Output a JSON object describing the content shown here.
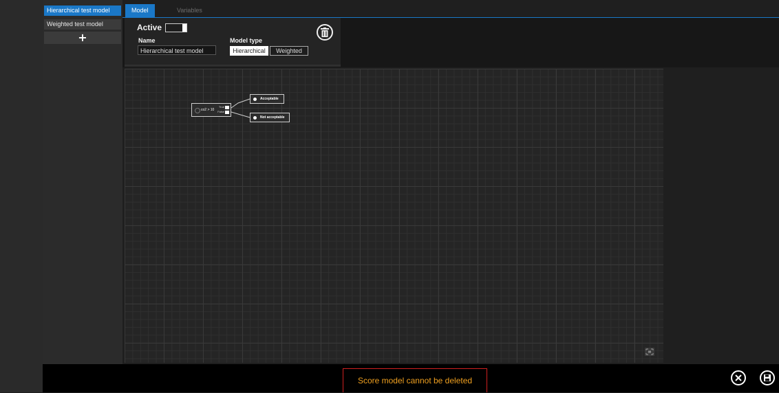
{
  "sidebar": {
    "items": [
      {
        "label": "Hierarchical test model",
        "active": true
      },
      {
        "label": "Weighted test model",
        "active": false
      }
    ],
    "add_label": "+"
  },
  "tabs": [
    {
      "label": "Model",
      "active": true
    },
    {
      "label": "Variables",
      "active": false
    }
  ],
  "model": {
    "active_label": "Active",
    "active_on": true,
    "name_label": "Name",
    "name_value": "Hierarchical test model",
    "type_label": "Model type",
    "types": [
      "Hierarchical",
      "Weighted"
    ],
    "selected_type": "Hierarchical",
    "delete_icon": "trash-icon"
  },
  "graph": {
    "condition": {
      "text": "co2 > 10",
      "true_label": "True",
      "false_label": "False"
    },
    "outputs": [
      "Acceptable",
      "Not acceptable"
    ]
  },
  "status": {
    "message": "Score model cannot be deleted"
  },
  "actions": {
    "close_icon": "close-circle-icon",
    "save_icon": "save-icon"
  },
  "colors": {
    "accent": "#1a78c8",
    "error_border": "#d02020",
    "error_text": "#f0a020"
  }
}
